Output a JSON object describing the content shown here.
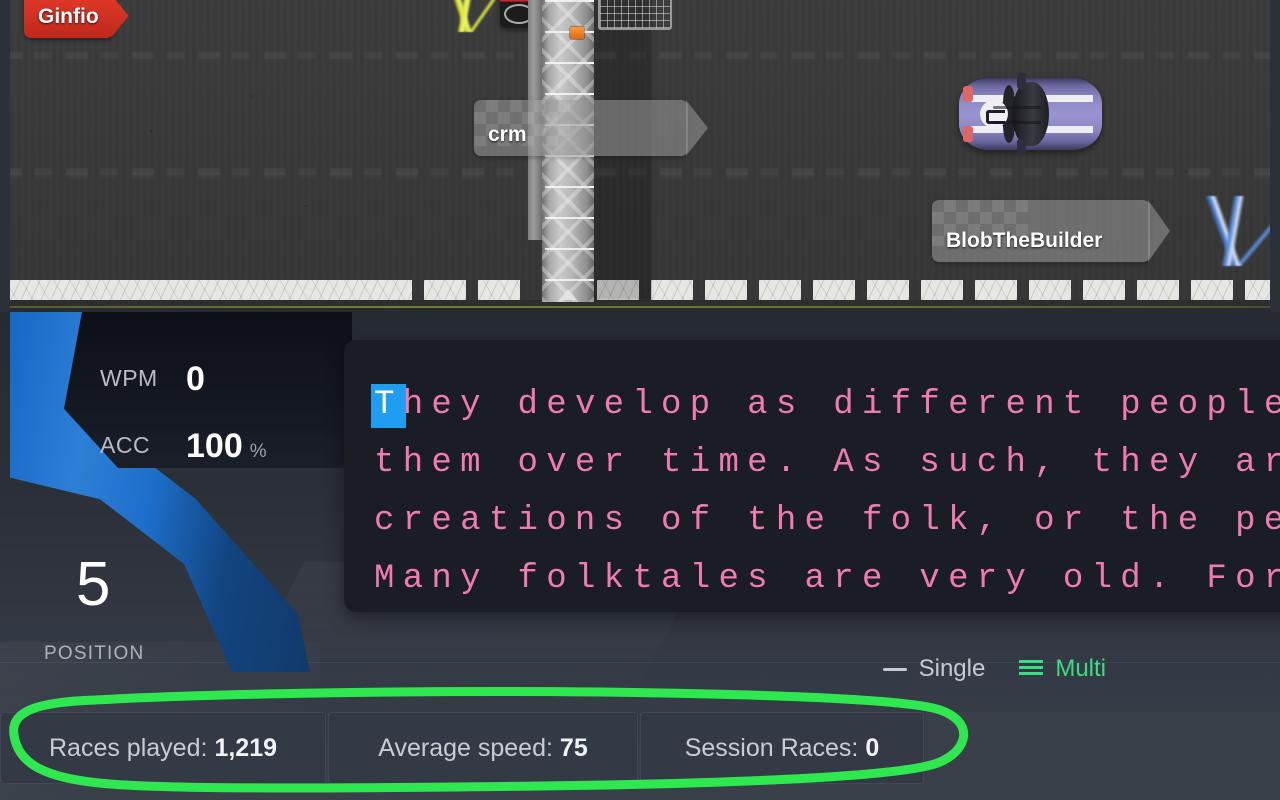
{
  "race": {
    "players": [
      {
        "name": "Ginfio",
        "tag_style": "red"
      },
      {
        "name": "crm",
        "tag_style": "grey"
      },
      {
        "name": "BlobTheBuilder",
        "tag_style": "grey"
      }
    ]
  },
  "hud": {
    "wpm": {
      "label": "WPM",
      "value": "0"
    },
    "accuracy": {
      "label": "ACC",
      "value": "100",
      "unit": "%"
    },
    "position": {
      "value": "5",
      "label": "POSITION"
    }
  },
  "typing": {
    "cursor_char": "T",
    "lines": [
      "hey develop as different people t",
      "them over time. As such, they are",
      "creations of the folk, or the peop",
      "Many folktales are very old. For"
    ],
    "text_color": "#f07bb0",
    "cursor_color": "#1f9df0"
  },
  "modes": {
    "single": {
      "label": "Single",
      "icon": "dash-icon",
      "active": false
    },
    "multi": {
      "label": "Multi",
      "icon": "lines-icon",
      "active": true
    },
    "active_color": "#3fdc7f"
  },
  "stats": [
    {
      "label": "Races played:",
      "value": "1,219"
    },
    {
      "label": "Average speed:",
      "value": "75"
    },
    {
      "label": "Session Races:",
      "value": "0"
    }
  ],
  "annotation": {
    "color": "#2fe84f",
    "shape": "hand-drawn-ellipse-around-stats"
  }
}
